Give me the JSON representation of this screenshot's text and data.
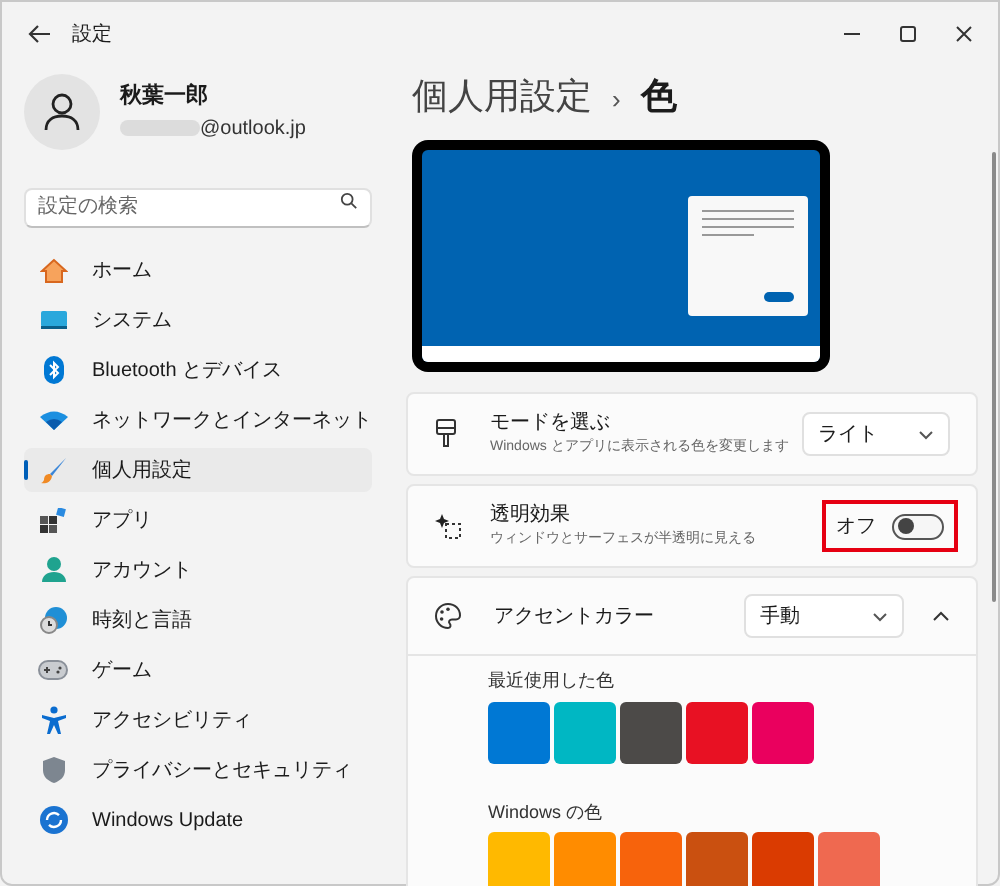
{
  "window": {
    "title": "設定"
  },
  "account": {
    "name": "秋葉一郎",
    "email": "@outlook.jp"
  },
  "search": {
    "placeholder": "設定の検索"
  },
  "sidebar": {
    "items": [
      {
        "label": "ホーム",
        "selected": false
      },
      {
        "label": "システム",
        "selected": false
      },
      {
        "label": "Bluetooth とデバイス",
        "selected": false
      },
      {
        "label": "ネットワークとインターネット",
        "selected": false
      },
      {
        "label": "個人用設定",
        "selected": true
      },
      {
        "label": "アプリ",
        "selected": false
      },
      {
        "label": "アカウント",
        "selected": false
      },
      {
        "label": "時刻と言語",
        "selected": false
      },
      {
        "label": "ゲーム",
        "selected": false
      },
      {
        "label": "アクセシビリティ",
        "selected": false
      },
      {
        "label": "プライバシーとセキュリティ",
        "selected": false
      },
      {
        "label": "Windows Update",
        "selected": false
      }
    ]
  },
  "breadcrumb": {
    "parent": "個人用設定",
    "separator": "›",
    "current": "色"
  },
  "mode": {
    "title": "モードを選ぶ",
    "description": "Windows とアプリに表示される色を変更します",
    "value": "ライト"
  },
  "transparency": {
    "title": "透明効果",
    "description": "ウィンドウとサーフェスが半透明に見える",
    "state_label": "オフ",
    "on": false,
    "highlighted": true
  },
  "accent": {
    "title": "アクセントカラー",
    "value": "手動",
    "expanded": true,
    "recent_label": "最近使用した色",
    "recent_colors": [
      {
        "color": "#0078d4"
      },
      {
        "color": "#00b7c3"
      },
      {
        "color": "#4c4a48"
      },
      {
        "color": "#e81123"
      },
      {
        "color": "#ea005e"
      }
    ],
    "windows_label": "Windows の色",
    "windows_colors": [
      {
        "color": "#ffb900"
      },
      {
        "color": "#ff8c00"
      },
      {
        "color": "#f7630c"
      },
      {
        "color": "#ca5010"
      },
      {
        "color": "#da3b01"
      },
      {
        "color": "#ef6950"
      }
    ]
  }
}
